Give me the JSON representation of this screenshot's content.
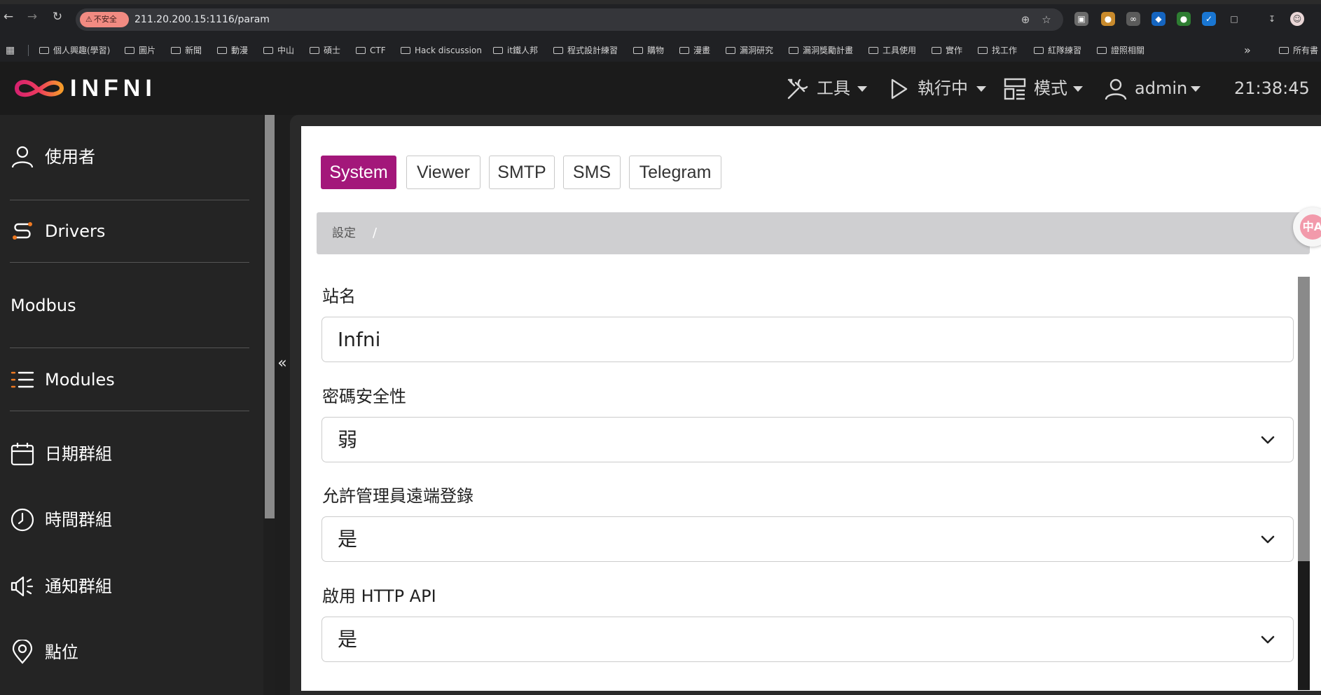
{
  "browser": {
    "insecure_label": "不安全",
    "url": "211.20.200.15:1116/param",
    "bookmarks": [
      "個人興趣(學習)",
      "圖片",
      "新聞",
      "動漫",
      "中山",
      "碩士",
      "CTF",
      "Hack discussion",
      "it鐵人邦",
      "程式設計練習",
      "購物",
      "漫畫",
      "漏洞研究",
      "漏洞獎勵計畫",
      "工具使用",
      "實作",
      "找工作",
      "紅隊練習",
      "證照相關"
    ],
    "bookmarks_more": "»",
    "bookmarks_all": "所有書"
  },
  "header": {
    "logo_text": "INFNI",
    "menu": [
      {
        "label": "工具",
        "icon": "tools-icon"
      },
      {
        "label": "執行中",
        "icon": "play-icon"
      },
      {
        "label": "模式",
        "icon": "layout-icon"
      },
      {
        "label": "admin",
        "icon": "user-icon"
      }
    ],
    "clock": "21:38:45"
  },
  "sidebar": {
    "items": [
      {
        "label": "使用者",
        "icon": "user-icon"
      },
      {
        "label": "Drivers",
        "icon": "drivers-icon"
      },
      {
        "label": "Modbus",
        "icon": ""
      },
      {
        "label": "Modules",
        "icon": "list-icon"
      },
      {
        "label": "日期群組",
        "icon": "calendar-icon"
      },
      {
        "label": "時間群組",
        "icon": "clock-icon"
      },
      {
        "label": "通知群組",
        "icon": "speaker-icon"
      },
      {
        "label": "點位",
        "icon": "map-pin-icon"
      }
    ],
    "collapse_glyph": "«"
  },
  "tabs": [
    {
      "label": "System",
      "active": true
    },
    {
      "label": "Viewer",
      "active": false
    },
    {
      "label": "SMTP",
      "active": false
    },
    {
      "label": "SMS",
      "active": false
    },
    {
      "label": "Telegram",
      "active": false
    }
  ],
  "breadcrumb": {
    "home": "設定",
    "separator": "/"
  },
  "translate_glyph": "中A",
  "form": {
    "fields": [
      {
        "label": "站名",
        "value": "Infni",
        "type": "text"
      },
      {
        "label": "密碼安全性",
        "value": "弱",
        "type": "select"
      },
      {
        "label": "允許管理員遠端登錄",
        "value": "是",
        "type": "select"
      },
      {
        "label": "啟用 HTTP API",
        "value": "是",
        "type": "select"
      }
    ]
  },
  "colors": {
    "accent": "#a3177a",
    "header_bg": "#1b1b1b",
    "sidebar_bg": "#242424",
    "sidebar_icon_accent": "#f07a22"
  }
}
